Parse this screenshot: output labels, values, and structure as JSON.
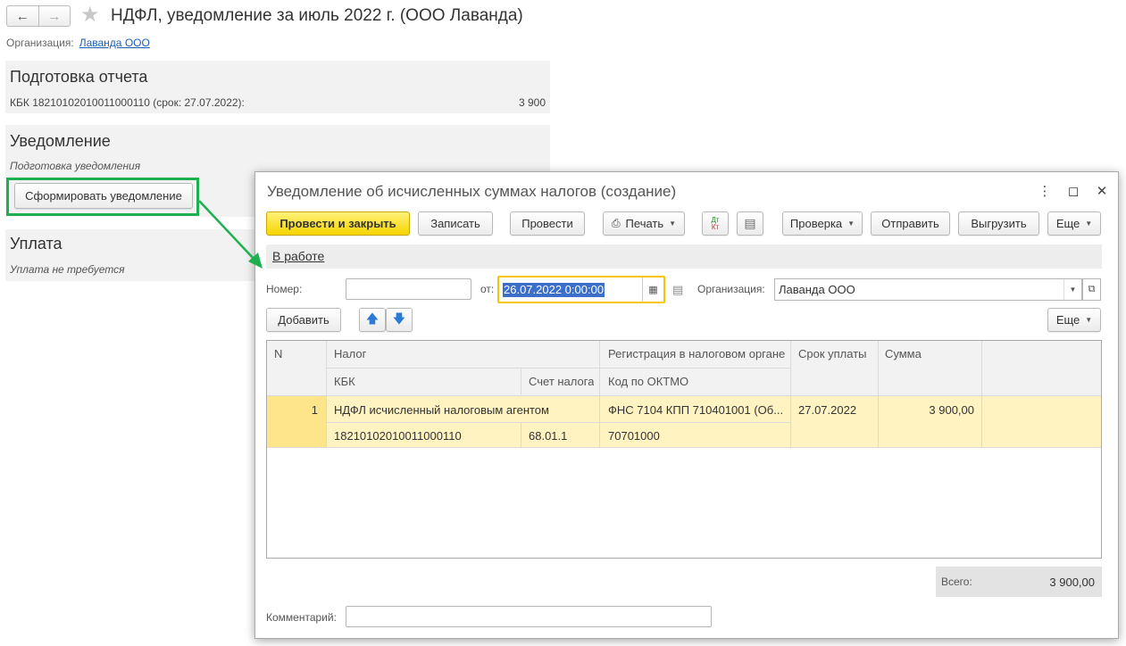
{
  "main": {
    "title": "НДФЛ, уведомление за июль 2022 г. (ООО Лаванда)",
    "org_label": "Организация:",
    "org_value": "Лаванда ООО",
    "report_group": {
      "title": "Подготовка отчета",
      "kbk_line": "КБК 18210102010011000110 (срок: 27.07.2022):",
      "amount": "3 900"
    },
    "notice_group": {
      "title": "Уведомление",
      "subtitle": "Подготовка уведомления",
      "button": "Сформировать уведомление"
    },
    "payment_group": {
      "title": "Уплата",
      "subtitle": "Уплата не требуется"
    }
  },
  "dialog": {
    "title": "Уведомление об исчисленных суммах налогов (создание)",
    "toolbar": {
      "post_close": "Провести и закрыть",
      "save": "Записать",
      "post": "Провести",
      "print": "Печать",
      "dt_kt": "Дт Кт",
      "check": "Проверка",
      "send": "Отправить",
      "upload": "Выгрузить",
      "more": "Еще"
    },
    "status": "В работе",
    "number_label": "Номер:",
    "number_value": "",
    "date_label": "от:",
    "date_value": "26.07.2022  0:00:00",
    "org_label": "Организация:",
    "org_value": "Лаванда ООО",
    "add_button": "Добавить",
    "more_button": "Еще",
    "table": {
      "headers": {
        "n": "N",
        "tax": "Налог",
        "kbk": "КБК",
        "account": "Счет налога",
        "registration": "Регистрация в налоговом органе",
        "oktmo": "Код по ОКТМО",
        "due": "Срок уплаты",
        "sum": "Сумма"
      },
      "rows": [
        {
          "n": "1",
          "tax": "НДФЛ исчисленный налоговым агентом",
          "kbk": "18210102010011000110",
          "account": "68.01.1",
          "registration": "ФНС 7104 КПП 710401001 (Об...",
          "oktmo": "70701000",
          "due": "27.07.2022",
          "sum": "3 900,00"
        }
      ]
    },
    "total_label": "Всего:",
    "total_value": "3 900,00",
    "comment_label": "Комментарий:",
    "comment_value": ""
  },
  "colors": {
    "primary_button": "#f6d400",
    "highlight": "#1eb050",
    "selected_row": "#fff3c2"
  }
}
